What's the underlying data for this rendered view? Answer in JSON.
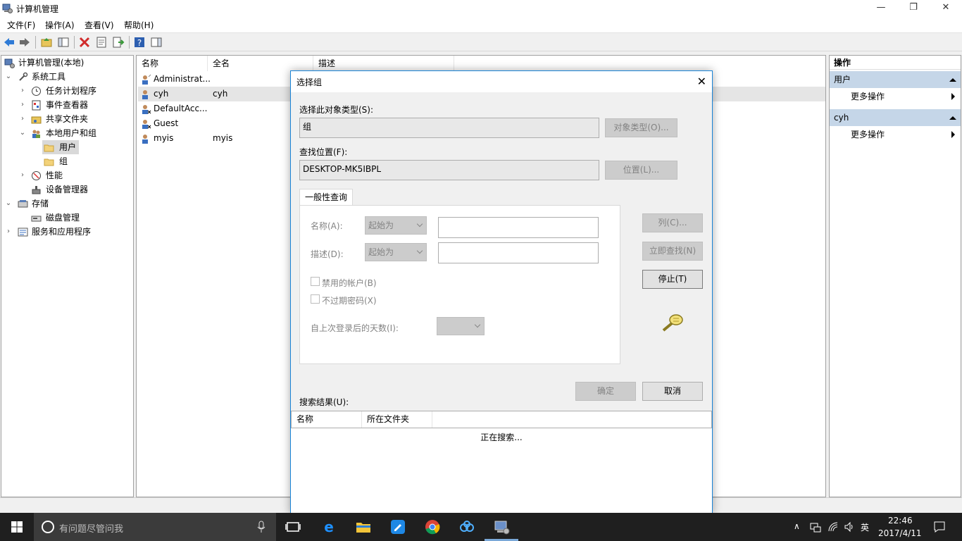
{
  "window": {
    "title": "计算机管理",
    "controls": {
      "minimize": "—",
      "restore": "❐",
      "close": "✕"
    }
  },
  "menu": [
    "文件(F)",
    "操作(A)",
    "查看(V)",
    "帮助(H)"
  ],
  "tree": {
    "root": "计算机管理(本地)",
    "items": [
      {
        "label": "系统工具",
        "level": 1,
        "expanded": true
      },
      {
        "label": "任务计划程序",
        "level": 2
      },
      {
        "label": "事件查看器",
        "level": 2
      },
      {
        "label": "共享文件夹",
        "level": 2
      },
      {
        "label": "本地用户和组",
        "level": 2,
        "expanded": true
      },
      {
        "label": "用户",
        "level": 3,
        "selected": true
      },
      {
        "label": "组",
        "level": 3
      },
      {
        "label": "性能",
        "level": 2
      },
      {
        "label": "设备管理器",
        "level": 2
      },
      {
        "label": "存储",
        "level": 1,
        "expanded": true
      },
      {
        "label": "磁盘管理",
        "level": 2
      },
      {
        "label": "服务和应用程序",
        "level": 1
      }
    ]
  },
  "list": {
    "columns": [
      "名称",
      "全名",
      "描述"
    ],
    "rows": [
      {
        "name": "Administrat...",
        "full": ""
      },
      {
        "name": "cyh",
        "full": "cyh"
      },
      {
        "name": "DefaultAcc...",
        "full": ""
      },
      {
        "name": "Guest",
        "full": ""
      },
      {
        "name": "myis",
        "full": "myis"
      }
    ]
  },
  "actions": {
    "title": "操作",
    "groups": [
      {
        "label": "用户",
        "item": "更多操作"
      },
      {
        "label": "cyh",
        "item": "更多操作"
      }
    ]
  },
  "dialog": {
    "title": "选择组",
    "object_type_label": "选择此对象类型(S):",
    "object_type_value": "组",
    "object_type_btn": "对象类型(O)...",
    "location_label": "查找位置(F):",
    "location_value": "DESKTOP-MK5IBPL",
    "location_btn": "位置(L)...",
    "tab": "一般性查询",
    "name_label": "名称(A):",
    "name_combo": "起始为",
    "desc_label": "描述(D):",
    "desc_combo": "起始为",
    "disabled_accounts": "禁用的帐户(B)",
    "non_expiring": "不过期密码(X)",
    "days_label": "自上次登录后的天数(I):",
    "columns_btn": "列(C)...",
    "find_now_btn": "立即查找(N)",
    "stop_btn": "停止(T)",
    "ok_btn": "确定",
    "cancel_btn": "取消",
    "results_label": "搜索结果(U):",
    "results_columns": [
      "名称",
      "所在文件夹"
    ],
    "searching": "正在搜索..."
  },
  "taskbar": {
    "search_placeholder": "有问题尽管问我",
    "ime": "英",
    "time": "22:46",
    "date": "2017/4/11"
  }
}
